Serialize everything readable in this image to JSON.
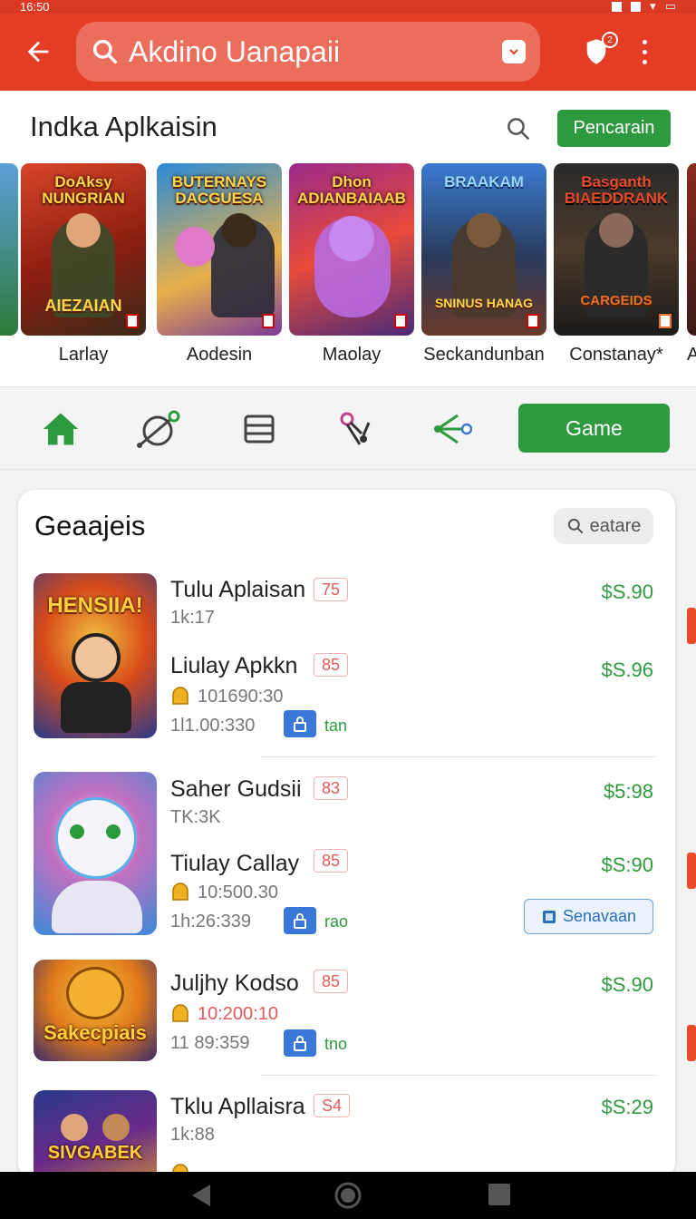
{
  "status_bar": {
    "time": "16:50"
  },
  "app_bar": {
    "search_query": "Akdino Uanapaii",
    "notification_count": "2"
  },
  "featured": {
    "title": "Indka Aplkaisin",
    "search_button_label": "Pencarain",
    "games": [
      {
        "name": "Larlay",
        "art_title": "DoAksy NUNGRIAN",
        "art_subtitle": "AIEZAIAN"
      },
      {
        "name": "Aodesin",
        "art_title": "BUTERNAYS DACGUESA",
        "art_subtitle": ""
      },
      {
        "name": "Maolay",
        "art_title": "Dhon ADIANBAIAAB",
        "art_subtitle": ""
      },
      {
        "name": "Seckandunban",
        "art_title": "BRAAKAM",
        "art_subtitle": "SNINUS HANAG"
      },
      {
        "name": "Constanay*",
        "art_title": "Basganth BIAEDDRANK",
        "art_subtitle": "CARGEIDS"
      }
    ],
    "edge_right_name": "A"
  },
  "nav": {
    "game_button": "Game"
  },
  "list": {
    "title": "Geaajeis",
    "search_label": "eatare",
    "groups": [
      {
        "thumb_text": "HENSIIA!",
        "items": [
          {
            "name": "Tulu Aplaisan",
            "badge": "75",
            "price": "$S.90",
            "sub": "1k:17"
          },
          {
            "name": "Liulay Apkkn",
            "badge": "85",
            "price": "$S.96",
            "meta1": "101690:30",
            "meta2": "1l1.00:330",
            "lock_label": "tan"
          }
        ]
      },
      {
        "thumb_text": "",
        "items": [
          {
            "name": "Saher Gudsii",
            "badge": "83",
            "price": "$5:98",
            "sub": "TK:3K"
          },
          {
            "name": "Tiulay Callay",
            "badge": "85",
            "price": "$S:90",
            "meta1": "10:500.30",
            "meta2": "1h:26:339",
            "lock_label": "rao"
          }
        ],
        "action_button": "Senavaan"
      },
      {
        "thumb_text": "Sakecpiais",
        "items": [
          {
            "name": "Juljhy Kodso",
            "badge": "85",
            "price": "$S.90",
            "meta1": "10:200:10",
            "meta2": "11 89:359",
            "lock_label": "tno"
          }
        ]
      },
      {
        "thumb_text": "SIVGABEK",
        "items": [
          {
            "name": "Tklu Apllaisra",
            "badge": "S4",
            "price": "$S:29",
            "sub": "1k:88"
          }
        ]
      }
    ]
  },
  "colors": {
    "primary_red": "#e43d25",
    "green": "#2e9a3f",
    "price_green": "#2f9a3c",
    "badge_red": "#e25a5a",
    "lock_blue": "#3a78d8"
  },
  "icons": [
    "back-arrow-icon",
    "search-icon",
    "pocket-icon",
    "shield-icon",
    "more-vert-icon",
    "home-icon",
    "explore-icon",
    "list-icon",
    "connect-icon",
    "share-icon",
    "coin-icon",
    "lock-icon",
    "book-icon",
    "nav-back-icon",
    "nav-home-icon",
    "nav-recents-icon"
  ]
}
